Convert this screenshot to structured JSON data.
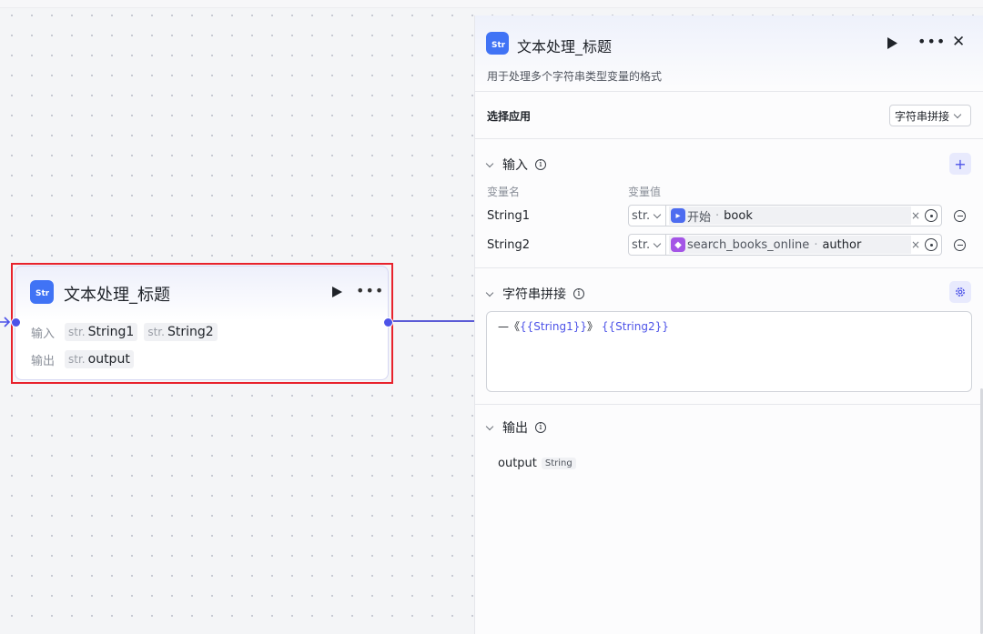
{
  "node": {
    "title": "文本处理_标题",
    "input_label": "输入",
    "output_label": "输出",
    "type_prefix": "str.",
    "inputs": [
      "String1",
      "String2"
    ],
    "output": "output",
    "icon": "text-process-icon"
  },
  "panel": {
    "title": "文本处理_标题",
    "description": "用于处理多个字符串类型变量的格式",
    "select_app_label": "选择应用",
    "select_app_value": "字符串拼接",
    "input_section": "输入",
    "col_var_name": "变量名",
    "col_var_value": "变量值",
    "variables": [
      {
        "name": "String1",
        "type": "str.",
        "source": "开始",
        "field": "book",
        "source_color": "#4d6cf0"
      },
      {
        "name": "String2",
        "type": "str.",
        "source": "search_books_online",
        "field": "author",
        "source_color": "#a455e6"
      }
    ],
    "concat_section": "字符串拼接",
    "template_prefix": "—《",
    "template_var1": "{{String1}}",
    "template_mid": "》",
    "template_var2": "{{String2}}",
    "output_section": "输出",
    "output_name": "output",
    "output_type": "String",
    "add_symbol": "+",
    "clear_symbol": "×"
  },
  "colors": {
    "accent": "#4d53e8",
    "highlight": "#e8222c",
    "node_icon": "#4073f5"
  }
}
